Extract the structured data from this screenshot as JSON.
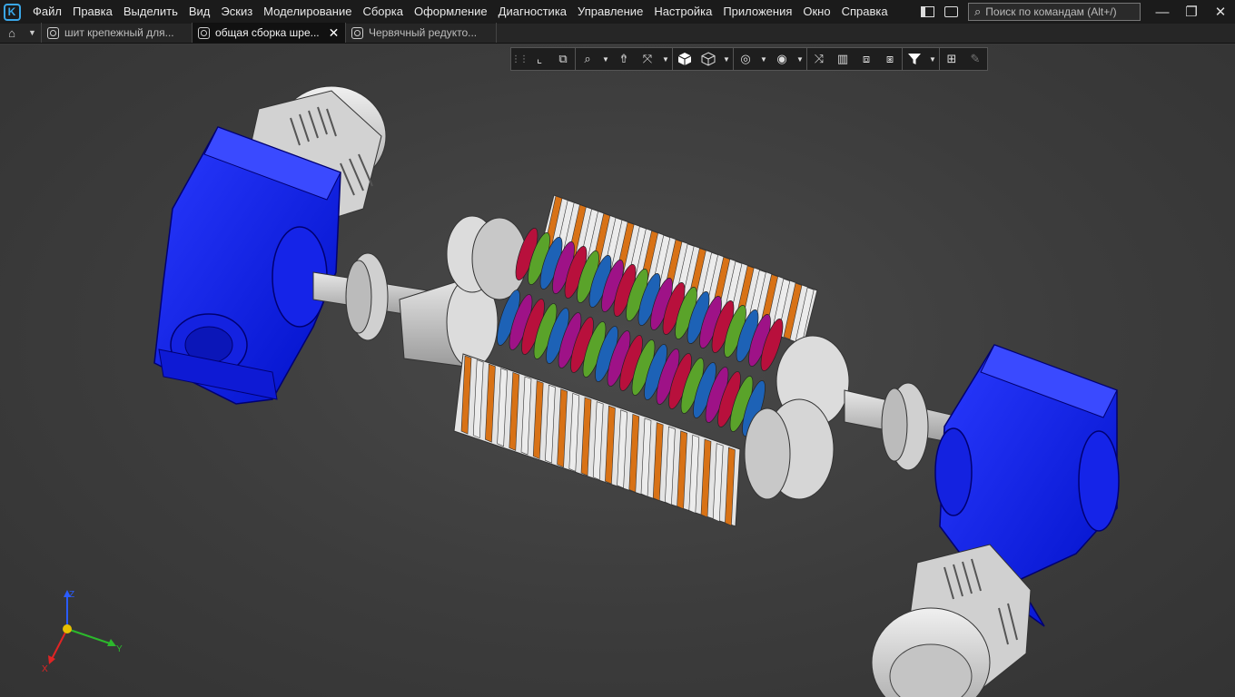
{
  "app": {
    "logo_letter": "K"
  },
  "menu": {
    "items": [
      "Файл",
      "Правка",
      "Выделить",
      "Вид",
      "Эскиз",
      "Моделирование",
      "Сборка",
      "Оформление",
      "Диагностика",
      "Управление",
      "Настройка",
      "Приложения",
      "Окно",
      "Справка"
    ]
  },
  "search": {
    "placeholder": "Поиск по командам (Alt+/)"
  },
  "window_controls": {
    "minimize": "—",
    "restore": "❐",
    "close": "✕"
  },
  "tabs": [
    {
      "label": "шит крепежный для...",
      "active": false
    },
    {
      "label": "общая сборка  шре...",
      "active": true
    },
    {
      "label": "Червячный редукто...",
      "active": false
    }
  ],
  "triad": {
    "x_label": "X",
    "y_label": "Y",
    "z_label": "Z"
  },
  "colors": {
    "gearbox_blue": "#0a1aee",
    "motor_grey": "#d8d8d8",
    "plate_orange": "#d87216",
    "cutter_red": "#b8103c",
    "cutter_green": "#5aa32a",
    "cutter_blue": "#1d62b6",
    "cutter_magenta": "#9e1287"
  }
}
